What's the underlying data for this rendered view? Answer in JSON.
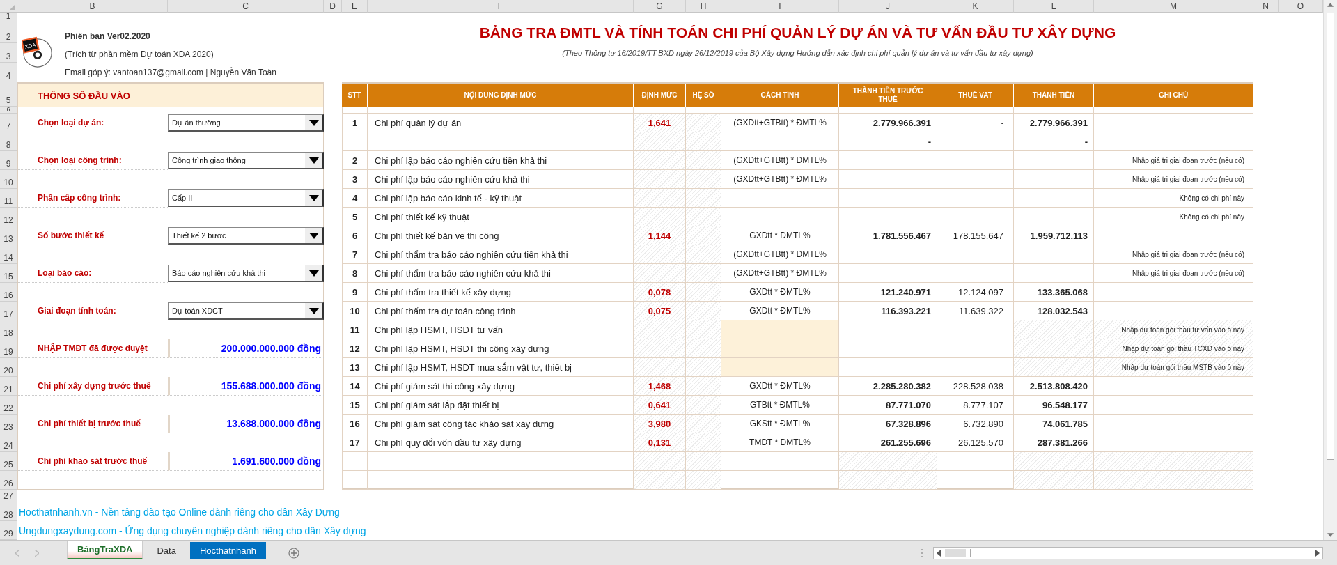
{
  "columns": [
    "B",
    "C",
    "D",
    "E",
    "F",
    "G",
    "H",
    "I",
    "J",
    "K",
    "L",
    "M",
    "N",
    "O"
  ],
  "rows": [
    "1",
    "2",
    "3",
    "4",
    "5",
    "6",
    "7",
    "8",
    "9",
    "10",
    "11",
    "12",
    "13",
    "14",
    "15",
    "16",
    "17",
    "18",
    "19",
    "20",
    "21",
    "22",
    "23",
    "24",
    "25",
    "26",
    "27",
    "28",
    "29"
  ],
  "header": {
    "logo_text": "XDA",
    "version": "Phiên bản Ver02.2020",
    "source": "(Trích từ phần mềm Dự toán XDA 2020)",
    "contact": "Email góp ý: vantoan137@gmail.com | Nguyễn Văn Toàn"
  },
  "title": "BẢNG TRA ĐMTL VÀ TÍNH TOÁN CHI PHÍ QUẢN LÝ DỰ ÁN VÀ TƯ VẤN ĐẦU TƯ XÂY DỰNG",
  "subtitle": "(Theo Thông tư 16/2019/TT-BXD ngày 26/12/2019 của Bộ Xây dựng Hướng dẫn xác định chi phí quản lý dự án và tư vấn đầu tư xây dựng)",
  "input_panel": {
    "title": "THÔNG SỐ ĐẦU VÀO",
    "fields": [
      {
        "kind": "select",
        "label": "Chọn loại dự án:",
        "value": "Dự án thường"
      },
      {
        "kind": "select",
        "label": "Chọn loại công trình:",
        "value": "Công trình giao thông"
      },
      {
        "kind": "select",
        "label": "Phân cấp công trình:",
        "value": "Cấp II"
      },
      {
        "kind": "select",
        "label": "Số bước thiết kế",
        "value": "Thiết kế 2 bước"
      },
      {
        "kind": "select",
        "label": "Loại báo cáo:",
        "value": "Báo cáo nghiên cứu khả thi"
      },
      {
        "kind": "select",
        "label": "Giai đoạn tính toán:",
        "value": "Dự toán XDCT"
      },
      {
        "kind": "amount",
        "label": "NHẬP TMĐT đã được duyệt",
        "value": "200.000.000.000 đồng"
      },
      {
        "kind": "amount",
        "label": "Chi phí xây dựng trước thuế",
        "value": "155.688.000.000 đồng"
      },
      {
        "kind": "amount",
        "label": "Chi phí thiết bị trước thuế",
        "value": "13.688.000.000 đồng"
      },
      {
        "kind": "amount",
        "label": "Chi phí khảo sát trước thuế",
        "value": "1.691.600.000 đồng"
      }
    ]
  },
  "table": {
    "columns": [
      "STT",
      "NỘI DUNG ĐỊNH MỨC",
      "ĐỊNH MỨC",
      "HỆ SỐ",
      "CÁCH TÍNH",
      "THÀNH TIỀN TRƯỚC THUẾ",
      "THUẾ VAT",
      "THÀNH TIỀN",
      "GHI CHÚ"
    ],
    "rows": [
      {
        "kind": "calc",
        "stt": "1",
        "content": "Chi phí quản lý dự án",
        "rate": "1,641",
        "method": "(GXDtt+GTBtt) * ĐMTL%",
        "pre_tax": "2.779.966.391",
        "vat": "-",
        "total": "2.779.966.391"
      },
      {
        "kind": "spacer",
        "pre_tax": "-",
        "total": "-"
      },
      {
        "kind": "calc",
        "stt": "2",
        "content": "Chi phí lập báo cáo nghiên cứu tiền khả thi",
        "method": "(GXDtt+GTBtt) * ĐMTL%",
        "note": "Nhập giá trị giai đoạn trước (nếu có)"
      },
      {
        "kind": "calc",
        "stt": "3",
        "content": "Chi phí lập báo cáo nghiên cứu khả thi",
        "method": "(GXDtt+GTBtt) * ĐMTL%",
        "note": "Nhập giá trị giai đoạn trước (nếu có)"
      },
      {
        "kind": "calc",
        "stt": "4",
        "content": "Chi phí lập báo cáo kinh tế - kỹ thuật",
        "note": "Không có chi phí này"
      },
      {
        "kind": "calc",
        "stt": "5",
        "content": "Chi phí thiết kế kỹ thuật",
        "note": "Không có chi phí này"
      },
      {
        "kind": "calc",
        "stt": "6",
        "content": "Chi phí thiết kế bản vẽ thi công",
        "rate": "1,144",
        "method": "GXDtt * ĐMTL%",
        "pre_tax": "1.781.556.467",
        "vat": "178.155.647",
        "total": "1.959.712.113"
      },
      {
        "kind": "calc",
        "stt": "7",
        "content": "Chi phí thẩm tra báo cáo nghiên cứu tiền khả thi",
        "method": "(GXDtt+GTBtt) * ĐMTL%",
        "note": "Nhập giá trị giai đoạn trước (nếu có)"
      },
      {
        "kind": "calc",
        "stt": "8",
        "content": "Chi phí thẩm tra báo cáo nghiên cứu khả thi",
        "method": "(GXDtt+GTBtt) * ĐMTL%",
        "note": "Nhập giá trị giai đoạn trước (nếu có)"
      },
      {
        "kind": "calc",
        "stt": "9",
        "content": "Chi phí thẩm tra thiết kế xây dựng",
        "rate": "0,078",
        "method": "GXDtt * ĐMTL%",
        "pre_tax": "121.240.971",
        "vat": "12.124.097",
        "total": "133.365.068"
      },
      {
        "kind": "calc",
        "stt": "10",
        "content": "Chi phí thẩm tra dự toán công trình",
        "rate": "0,075",
        "method": "GXDtt * ĐMTL%",
        "pre_tax": "116.393.221",
        "vat": "11.639.322",
        "total": "128.032.543"
      },
      {
        "kind": "tender",
        "stt": "11",
        "content": "Chi phí lập HSMT, HSDT tư vấn",
        "note": "Nhập dự toán gói thầu tư vấn vào ô này"
      },
      {
        "kind": "tender",
        "stt": "12",
        "content": "Chi phí lập HSMT, HSDT thi công xây dựng",
        "note": "Nhập dự toán gói thầu TCXD vào ô này"
      },
      {
        "kind": "tender",
        "stt": "13",
        "content": "Chi phí lập HSMT, HSDT mua sắm vật tư, thiết bị",
        "note": "Nhập dự toán gói thầu MSTB vào ô này"
      },
      {
        "kind": "calc",
        "stt": "14",
        "content": "Chi phí giám sát thi công xây dựng",
        "rate": "1,468",
        "method": "GXDtt * ĐMTL%",
        "pre_tax": "2.285.280.382",
        "vat": "228.528.038",
        "total": "2.513.808.420"
      },
      {
        "kind": "calc",
        "stt": "15",
        "content": "Chi phí giám sát lắp đặt thiết bị",
        "rate": "0,641",
        "method": "GTBtt * ĐMTL%",
        "pre_tax": "87.771.070",
        "vat": "8.777.107",
        "total": "96.548.177"
      },
      {
        "kind": "calc",
        "stt": "16",
        "content": "Chi phí giám sát công tác khảo sát xây dựng",
        "rate": "3,980",
        "method": "GKStt * ĐMTL%",
        "pre_tax": "67.328.896",
        "vat": "6.732.890",
        "total": "74.061.785"
      },
      {
        "kind": "calc",
        "stt": "17",
        "content": "Chi phí quy đổi vốn đầu tư xây dựng",
        "rate": "0,131",
        "method": "TMĐT * ĐMTL%",
        "pre_tax": "261.255.696",
        "vat": "26.125.570",
        "total": "287.381.266"
      },
      {
        "kind": "blank"
      },
      {
        "kind": "blank"
      }
    ]
  },
  "links": [
    "Hocthatnhanh.vn - Nền tảng đào tạo Online dành riêng cho dân Xây Dựng",
    "Ungdungxaydung.com - Ứng dụng chuyên nghiệp dành riêng cho dân Xây dựng"
  ],
  "sheet_tabs": [
    {
      "label": "BảngTraXDA",
      "selected": true
    },
    {
      "label": "Data",
      "selected": false
    },
    {
      "label": "Hocthatnhanh",
      "selected": false,
      "color": "#0070c0"
    }
  ]
}
